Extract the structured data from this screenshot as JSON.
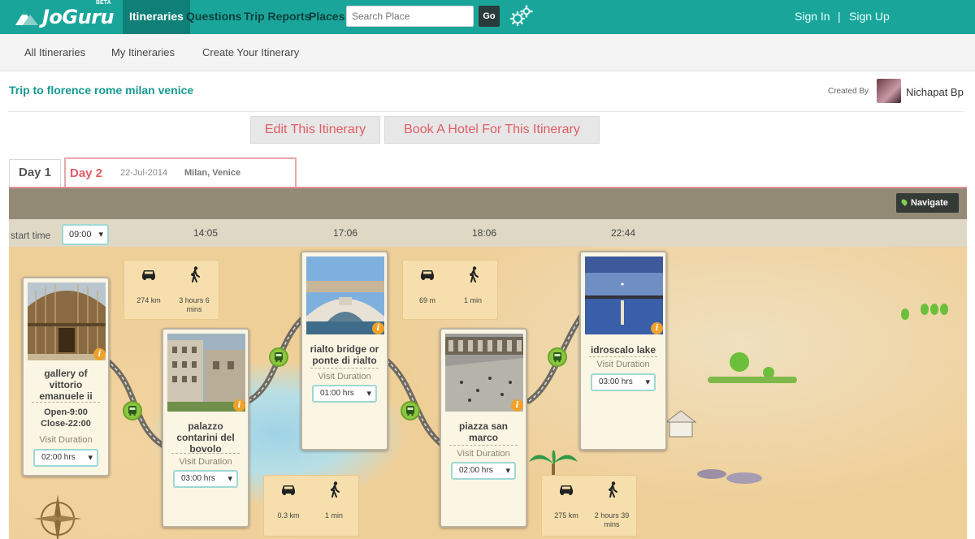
{
  "brand": {
    "name": "JoGuru",
    "beta": "BETA"
  },
  "nav": {
    "tabs": [
      {
        "label": "Itineraries",
        "active": true
      },
      {
        "label": "Questions",
        "active": false
      },
      {
        "label": "Trip Reports",
        "active": false
      },
      {
        "label": "Places",
        "active": false
      }
    ],
    "search_placeholder": "Search Place",
    "go_label": "Go",
    "sign_in": "Sign In",
    "separator": "|",
    "sign_up": "Sign Up"
  },
  "subnav": [
    "All Itineraries",
    "My Itineraries",
    "Create Your Itinerary"
  ],
  "trip": {
    "title": "Trip to florence rome milan venice",
    "created_by_label": "Created By",
    "creator": "Nichapat Bp"
  },
  "actions": {
    "edit": "Edit This Itinerary",
    "book": "Book A Hotel For This Itinerary"
  },
  "days": [
    {
      "label": "Day 1"
    },
    {
      "label": "Day 2",
      "date": "22-Jul-2014",
      "places": "Milan, Venice",
      "active": true
    }
  ],
  "navigate_label": "Navigate",
  "timeline": {
    "start_label": "start time",
    "start_value": "09:00",
    "times": [
      "14:05",
      "17:06",
      "18:06",
      "22:44"
    ]
  },
  "stops": [
    {
      "name": "gallery of vittorio emanuele ii",
      "open": "Open-9:00",
      "close": "Close-22:00",
      "visit_label": "Visit Duration",
      "duration": "02:00 hrs"
    },
    {
      "name": "palazzo contarini del bovolo",
      "visit_label": "Visit Duration",
      "duration": "03:00 hrs"
    },
    {
      "name": "rialto bridge or ponte di rialto",
      "visit_label": "Visit Duration",
      "duration": "01:00 hrs"
    },
    {
      "name": "piazza san marco",
      "visit_label": "Visit Duration",
      "duration": "02:00 hrs"
    },
    {
      "name": "idroscalo lake",
      "visit_label": "Visit Duration",
      "duration": "03:00 hrs"
    }
  ],
  "transits": [
    {
      "drive": "274 km",
      "walk": "3 hours 6 mins"
    },
    {
      "drive": "0.3 km",
      "walk": "1 min"
    },
    {
      "drive": "69 m",
      "walk": "1 min"
    },
    {
      "drive": "275 km",
      "walk": "2 hours 39 mins"
    }
  ],
  "info_glyph": "i",
  "colors": {
    "teal": "#1aa59b",
    "accent_red": "#e05d66",
    "map_sand": "#efcf98",
    "bus_green": "#8cc63f"
  }
}
